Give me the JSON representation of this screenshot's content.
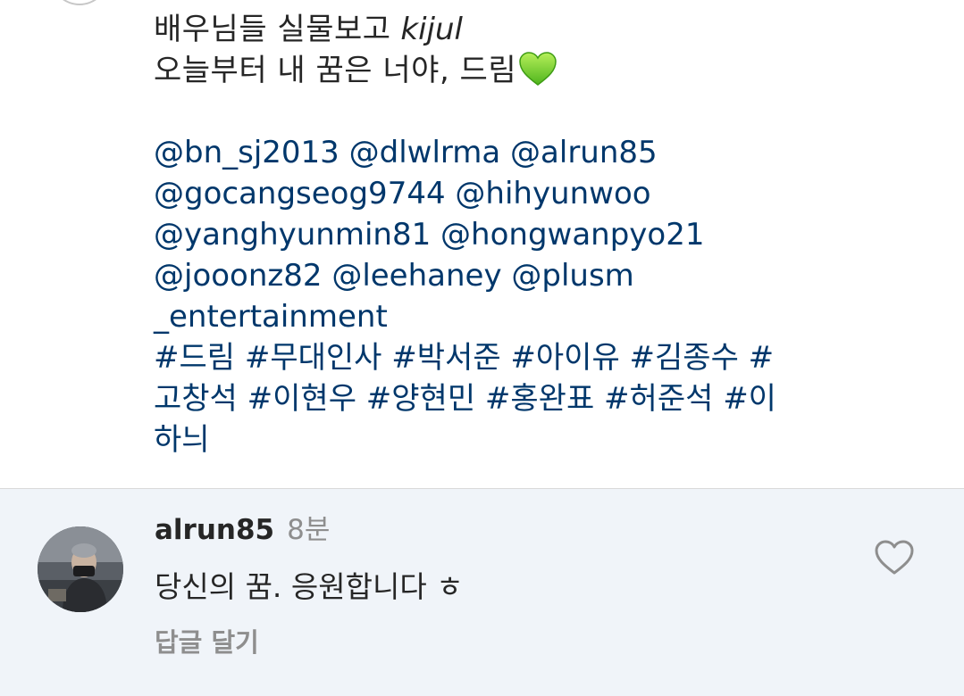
{
  "post": {
    "caption_line1_kr": "배우님들 실물보고",
    "caption_line1_italic": "kijul",
    "caption_line2": "오늘부터 내 꿈은 너야, 드림",
    "mentions_lines": [
      "@bn_sj2013 @dlwlrma @alrun85",
      "@gocangseog9744 @hihyunwoo",
      "@yanghyunmin81 @hongwanpyo21",
      "@jooonz82 @leehaney @plusm",
      "_entertainment"
    ],
    "hashtag_lines": [
      "#드림 #무대인사 #박서준 #아이유 #김종수 #",
      "고창석 #이현우 #양현민 #홍완표 #허준석 #이",
      "하늬"
    ],
    "emoji_icon": "green-heart-icon",
    "colors": {
      "link": "#00376b",
      "green_heart": "#7ed321"
    }
  },
  "comment": {
    "username": "alrun85",
    "time": "8분",
    "text": "당신의 꿈. 응원합니다 ㅎ",
    "reply_label": "답글 달기",
    "like_icon": "heart-outline-icon",
    "background": "#f0f4f9"
  }
}
